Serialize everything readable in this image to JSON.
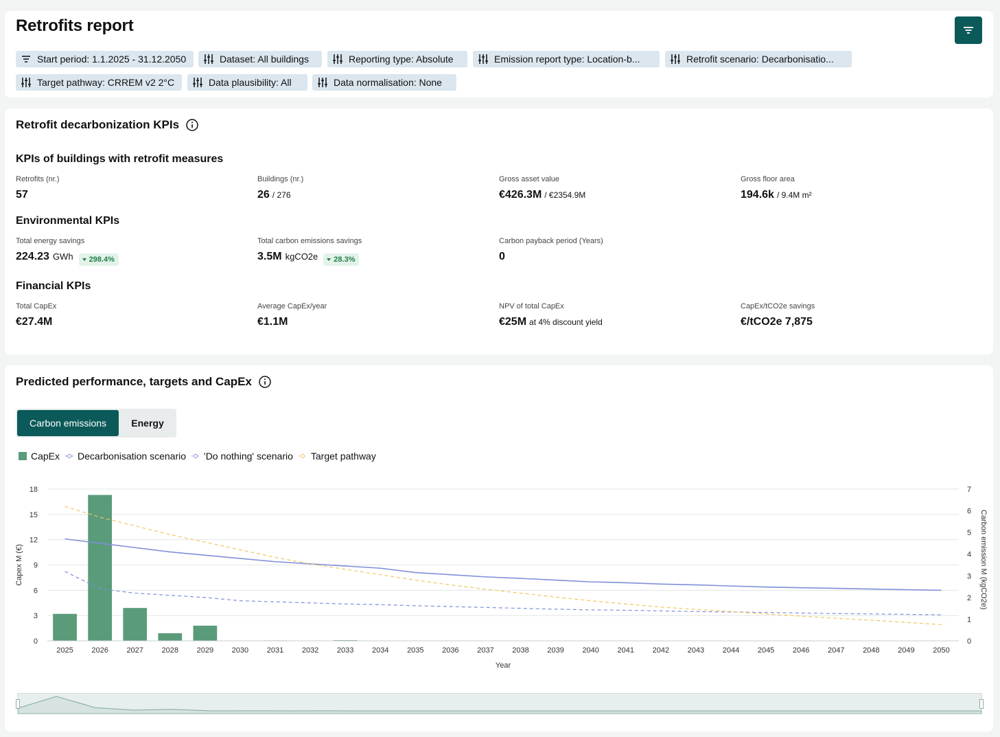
{
  "header": {
    "title": "Retrofits report",
    "filter_button_icon": "filter-icon",
    "chips": [
      {
        "label": "Start period: 1.1.2025 - 31.12.2050",
        "icon": "filter-lines-icon"
      },
      {
        "label": "Dataset: All buildings",
        "icon": "sliders-icon"
      },
      {
        "label": "Reporting type: Absolute",
        "icon": "sliders-icon"
      },
      {
        "label": "Emission report type: Location-b...",
        "icon": "sliders-icon"
      },
      {
        "label": "Retrofit scenario: Decarbonisatio...",
        "icon": "sliders-icon"
      },
      {
        "label": "Target pathway: CRREM v2 2°C",
        "icon": "sliders-icon"
      },
      {
        "label": "Data plausibility: All",
        "icon": "sliders-icon"
      },
      {
        "label": "Data normalisation: None",
        "icon": "sliders-icon"
      }
    ]
  },
  "kpis": {
    "title": "Retrofit decarbonization KPIs",
    "retrofit_group": {
      "title": "KPIs of buildings with retrofit measures",
      "retrofits": {
        "label": "Retrofits (nr.)",
        "value": "57"
      },
      "buildings": {
        "label": "Buildings (nr.)",
        "value": "26",
        "total": "/ 276"
      },
      "gav": {
        "label": "Gross asset value",
        "value": "€426.3M",
        "total": "/ €2354.9M"
      },
      "gfa": {
        "label": "Gross floor area",
        "value": "194.6k",
        "total": "/ 9.4M m²"
      }
    },
    "environmental": {
      "title": "Environmental KPIs",
      "energy_savings": {
        "label": "Total energy savings",
        "value": "224.23",
        "unit": "GWh",
        "badge": "298.4%"
      },
      "carbon_savings": {
        "label": "Total carbon emissions savings",
        "value": "3.5M",
        "unit": "kgCO2e",
        "badge": "28.3%"
      },
      "payback": {
        "label": "Carbon payback period (Years)",
        "value": "0"
      }
    },
    "financial": {
      "title": "Financial KPIs",
      "total_capex": {
        "label": "Total CapEx",
        "value": "€27.4M"
      },
      "avg_capex": {
        "label": "Average CapEx/year",
        "value": "€1.1M"
      },
      "npv": {
        "label": "NPV of total CapEx",
        "value": "€25M",
        "note": "at 4% discount yield"
      },
      "capex_per_t": {
        "label": "CapEx/tCO2e savings",
        "value": "€/tCO2e 7,875"
      }
    }
  },
  "performance": {
    "title": "Predicted performance, targets and CapEx",
    "tabs": {
      "active": "Carbon emissions",
      "inactive": "Energy"
    },
    "legend": {
      "capex": "CapEx",
      "decarb": "Decarbonisation scenario",
      "nothing": "'Do nothing' scenario",
      "target": "Target pathway"
    },
    "colors": {
      "capex": "#5a9b7a",
      "decarb": "#7f8fd8",
      "nothing": "#7f8fd8",
      "target": "#f1c65a"
    }
  },
  "chart_data": {
    "type": "bar",
    "xlabel": "Year",
    "ylabel": "Capex M (€)",
    "y2label": "Carbon emission M (kgCO2e)",
    "ylim": [
      0,
      18
    ],
    "y2lim": [
      0,
      7
    ],
    "yticks": [
      0,
      3,
      6,
      9,
      12,
      15,
      18
    ],
    "y2ticks": [
      0,
      1,
      2,
      3,
      4,
      5,
      6,
      7
    ],
    "categories": [
      "2025",
      "2026",
      "2027",
      "2028",
      "2029",
      "2030",
      "2031",
      "2032",
      "2033",
      "2034",
      "2035",
      "2036",
      "2037",
      "2038",
      "2039",
      "2040",
      "2041",
      "2042",
      "2043",
      "2044",
      "2045",
      "2046",
      "2047",
      "2048",
      "2049",
      "2050"
    ],
    "series": [
      {
        "name": "CapEx",
        "type": "bar",
        "axis": "left",
        "values": [
          3.2,
          17.3,
          3.9,
          0.9,
          1.8,
          0,
          0.05,
          0,
          0.08,
          0.02,
          0,
          0,
          0,
          0,
          0,
          0,
          0,
          0,
          0,
          0,
          0,
          0,
          0,
          0,
          0,
          0
        ]
      },
      {
        "name": "Decarbonisation scenario",
        "type": "line",
        "axis": "right",
        "dash": false,
        "values": [
          4.7,
          4.5,
          4.3,
          4.1,
          3.95,
          3.8,
          3.65,
          3.55,
          3.45,
          3.35,
          3.15,
          3.05,
          2.95,
          2.88,
          2.8,
          2.72,
          2.68,
          2.62,
          2.58,
          2.53,
          2.48,
          2.45,
          2.42,
          2.39,
          2.36,
          2.33
        ]
      },
      {
        "name": "'Do nothing' scenario",
        "type": "line",
        "axis": "right",
        "dash": true,
        "values": [
          3.2,
          2.4,
          2.2,
          2.1,
          2.0,
          1.85,
          1.8,
          1.75,
          1.7,
          1.67,
          1.62,
          1.58,
          1.54,
          1.5,
          1.46,
          1.43,
          1.41,
          1.38,
          1.35,
          1.33,
          1.31,
          1.28,
          1.26,
          1.24,
          1.22,
          1.2
        ]
      },
      {
        "name": "Target pathway",
        "type": "line",
        "axis": "right",
        "dash": true,
        "values": [
          6.2,
          5.7,
          5.3,
          4.9,
          4.55,
          4.2,
          3.85,
          3.55,
          3.3,
          3.05,
          2.8,
          2.58,
          2.38,
          2.2,
          2.02,
          1.85,
          1.7,
          1.56,
          1.45,
          1.35,
          1.24,
          1.14,
          1.04,
          0.95,
          0.85,
          0.75
        ]
      }
    ]
  }
}
